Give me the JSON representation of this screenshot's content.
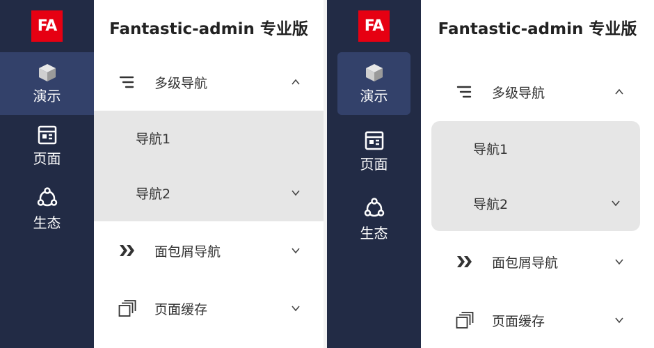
{
  "logo": {
    "text": "FA",
    "color": "#e60012"
  },
  "app_title": "Fantastic-admin 专业版",
  "rail": [
    {
      "label": "演示",
      "icon": "cube-icon"
    },
    {
      "label": "页面",
      "icon": "page-icon"
    },
    {
      "label": "生态",
      "icon": "ecosystem-icon"
    }
  ],
  "menu": [
    {
      "label": "多级导航",
      "icon": "list-icon",
      "expanded": true,
      "children": [
        {
          "label": "导航1"
        },
        {
          "label": "导航2",
          "has_children": true
        }
      ]
    },
    {
      "label": "面包屑导航",
      "icon": "double-chevron-icon",
      "expanded": false
    },
    {
      "label": "页面缓存",
      "icon": "windows-icon",
      "expanded": false
    }
  ],
  "colors": {
    "rail_bg": "#222b45",
    "rail_active": "#33416a",
    "submenu_bg": "#e6e6e6"
  }
}
